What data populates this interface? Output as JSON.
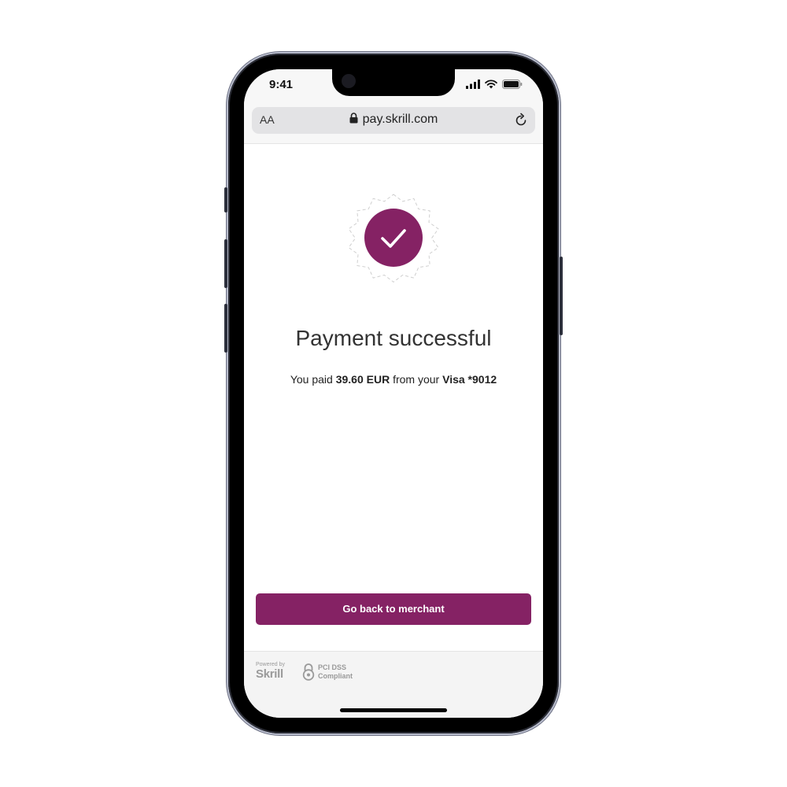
{
  "status_bar": {
    "time": "9:41",
    "icons": [
      "signal-icon",
      "wifi-icon",
      "battery-icon"
    ]
  },
  "browser": {
    "text_size_label": "AA",
    "url": "pay.skrill.com"
  },
  "payment": {
    "title": "Payment successful",
    "paid_prefix": "You paid ",
    "amount": "39.60 EUR",
    "paid_middle": " from your ",
    "card": "Visa *9012"
  },
  "actions": {
    "back_button_label": "Go back to merchant"
  },
  "footer": {
    "powered_by": "Powered by",
    "brand": "Skrill",
    "pci_line1": "PCI DSS",
    "pci_line2": "Compliant"
  },
  "colors": {
    "brand_accent": "#852264",
    "badge_outline": "#cfcfcf"
  }
}
